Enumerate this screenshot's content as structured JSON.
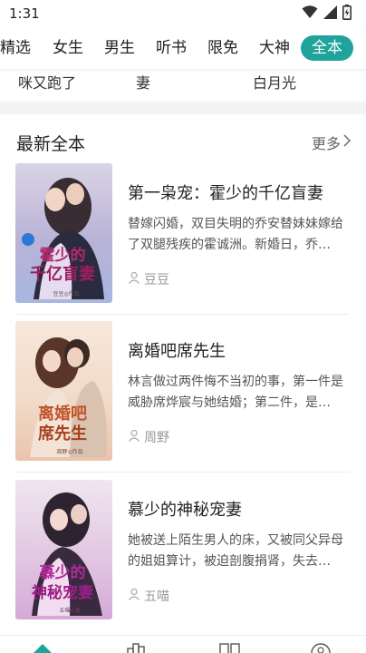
{
  "status_bar": {
    "time": "1:31"
  },
  "tabs": [
    {
      "label": "精选",
      "active": false
    },
    {
      "label": "女生",
      "active": false
    },
    {
      "label": "男生",
      "active": false
    },
    {
      "label": "听书",
      "active": false
    },
    {
      "label": "限免",
      "active": false
    },
    {
      "label": "大神",
      "active": false
    },
    {
      "label": "全本",
      "active": true
    }
  ],
  "previous_section": {
    "items": [
      "咪又跑了",
      "妻",
      "白月光"
    ]
  },
  "section": {
    "title": "最新全本",
    "more_label": "更多",
    "books": [
      {
        "title": "第一枭宠：霍少的千亿盲妻",
        "description": "替嫁闪婚，双目失明的乔安替妹妹嫁给了双腿残疾的霍诚洲。新婚日，乔…",
        "author": "豆豆",
        "cover_lines": [
          "霍少的",
          "千亿盲妻"
        ],
        "cover_caption": "豆豆◎作品"
      },
      {
        "title": "离婚吧席先生",
        "description": "林言做过两件悔不当初的事，第一件是威胁席烨宸与她结婚；第二件，是…",
        "author": "周野",
        "cover_lines": [
          "离婚吧",
          "席先生"
        ],
        "cover_caption": "周野◎作品"
      },
      {
        "title": "慕少的神秘宠妻",
        "description": "她被送上陌生男人的床，又被同父异母的姐姐算计，被迫剖腹捐肾，失去…",
        "author": "五喵",
        "cover_lines": [
          "慕少的",
          "神秘宠妻"
        ],
        "cover_caption": "五喵◎著"
      }
    ]
  },
  "colors": {
    "accent": "#1fa39a",
    "text": "#222222",
    "muted": "#999999"
  },
  "icons": [
    "wifi-icon",
    "signal-icon",
    "battery-icon",
    "chevron-right-icon",
    "user-icon"
  ]
}
